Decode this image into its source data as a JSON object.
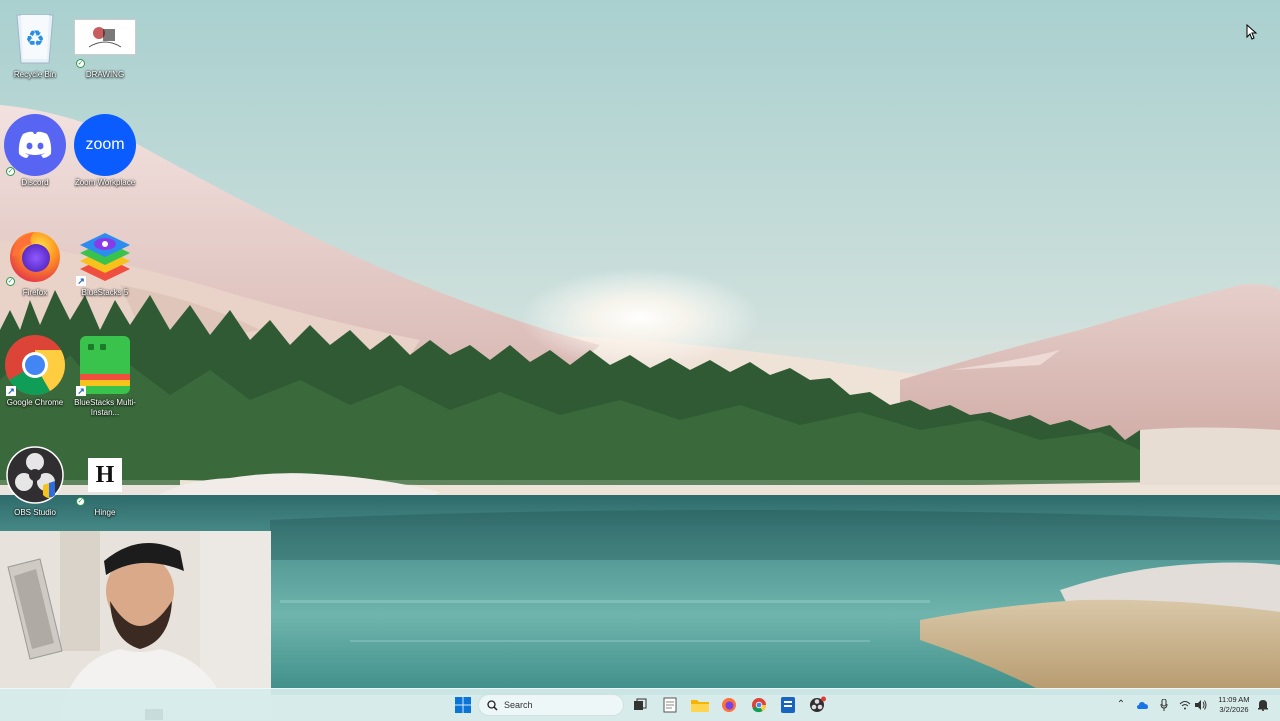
{
  "desktop": {
    "icons": [
      {
        "name": "recycle-bin",
        "label": "Recycle Bin"
      },
      {
        "name": "drawing",
        "label": "DRAWING"
      },
      {
        "name": "discord",
        "label": "Discord"
      },
      {
        "name": "zoom",
        "label": "Zoom Workplace",
        "logo_text": "zoom"
      },
      {
        "name": "firefox",
        "label": "Firefox"
      },
      {
        "name": "bluestacks",
        "label": "BlueStacks 5"
      },
      {
        "name": "google-chrome",
        "label": "Google Chrome"
      },
      {
        "name": "bluestacks-multi",
        "label": "BlueStacks Multi-Instan..."
      },
      {
        "name": "obs-studio",
        "label": "OBS Studio"
      },
      {
        "name": "hinge",
        "label": "Hinge",
        "logo_text": "H"
      }
    ]
  },
  "taskbar": {
    "search_placeholder": "Search",
    "pinned": [
      "start-icon",
      "search-icon",
      "task-view-icon",
      "notepad-icon",
      "file-explorer-icon",
      "firefox-icon",
      "chrome-icon",
      "store-icon",
      "obs-icon"
    ],
    "tray": [
      "chevron-up-icon",
      "onedrive-icon",
      "microphone-icon",
      "wifi-icon",
      "volume-icon"
    ],
    "clock_time": "11:09 AM",
    "clock_date": "3/2/2026"
  },
  "colors": {
    "taskbar_bg": "#d6ecec",
    "discord": "#5865f2",
    "zoom": "#0b5cff",
    "bluestacks_multi": "#3ac34c"
  }
}
